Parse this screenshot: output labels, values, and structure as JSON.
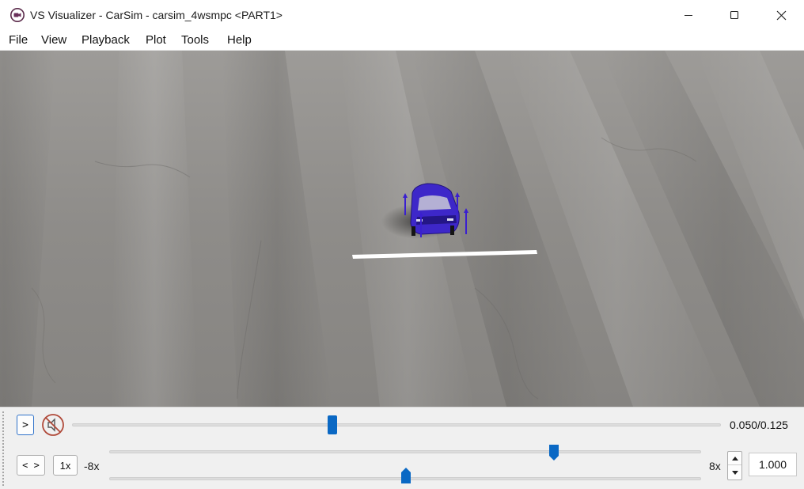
{
  "window": {
    "title": "VS Visualizer - CarSim - carsim_4wsmpc <PART1>",
    "icon": "vs-visualizer-camera-icon"
  },
  "menu": [
    "File",
    "View",
    "Playback",
    "Plot",
    "Tools",
    "Help"
  ],
  "colors": {
    "accent": "#0a68c4",
    "road": "#8f8d8a",
    "vehicle": "#3d27c9",
    "lane_marking": "#ffffff"
  },
  "playback": {
    "play_label": ">",
    "mute_icon": "speaker-muted-icon",
    "current_time": "0.050",
    "total_time": "0.125",
    "time_readout": "0.050/0.125",
    "time_slider_fraction": 0.4
  },
  "speed": {
    "bounce_label": "< >",
    "reset_label": "1x",
    "min_label": "-8x",
    "max_label": "8x",
    "rate_value": "1.000",
    "speed_slider_upper_fraction": 0.75,
    "speed_slider_lower_fraction": 0.5
  }
}
